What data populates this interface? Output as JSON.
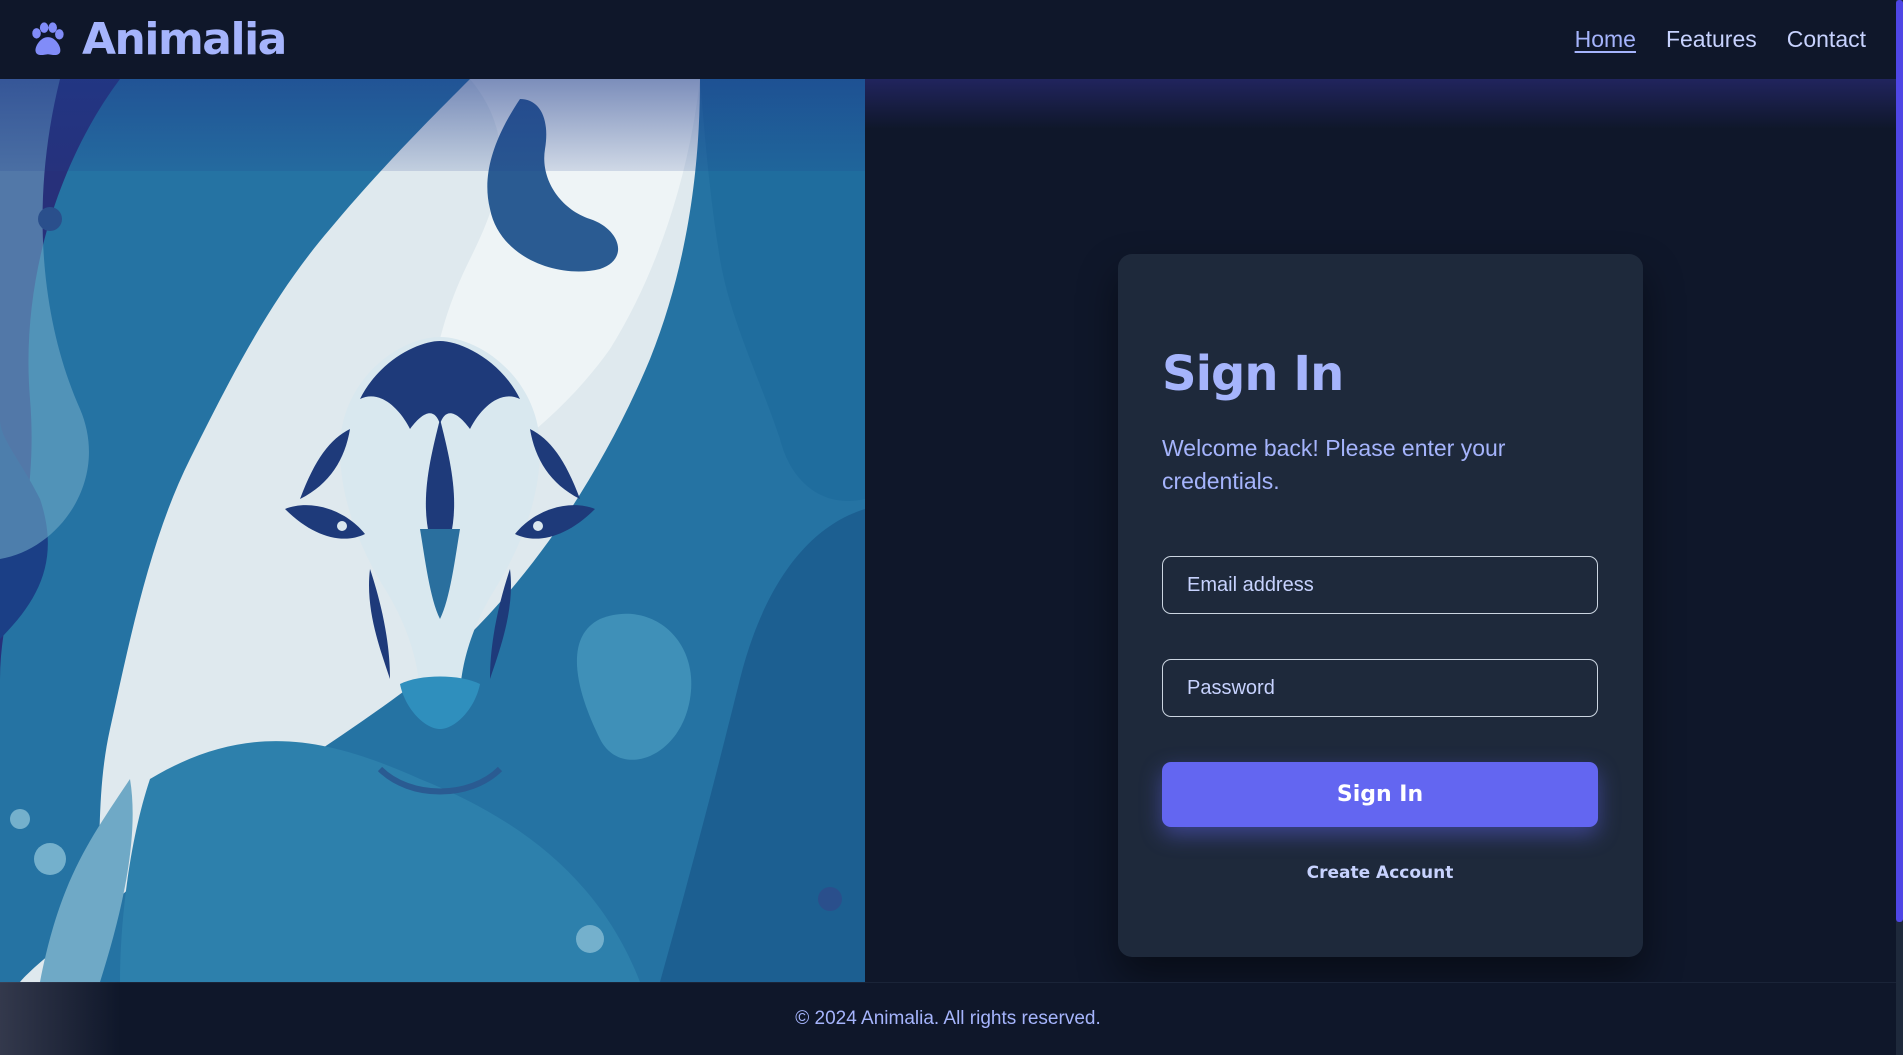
{
  "header": {
    "brand_name": "Animalia",
    "logo_icon": "paw-icon",
    "nav": [
      {
        "label": "Home",
        "active": true
      },
      {
        "label": "Features",
        "active": false
      },
      {
        "label": "Contact",
        "active": false
      }
    ]
  },
  "hero": {
    "image_subject": "stylized blue tiger face illustration"
  },
  "signin": {
    "title": "Sign In",
    "subtitle": "Welcome back! Please enter your credentials.",
    "email_placeholder": "Email address",
    "email_value": "",
    "password_placeholder": "Password",
    "password_value": "",
    "submit_label": "Sign In",
    "create_account_label": "Create Account"
  },
  "footer": {
    "text": "© 2024 Animalia. All rights reserved."
  },
  "colors": {
    "background": "#0f172a",
    "card": "#1e293b",
    "accent": "#6366f1",
    "accent_light": "#a5b4fc",
    "hero_dark_blue": "#1e3a8a",
    "hero_light": "#dbe7ee",
    "hero_teal": "#2a7aa8"
  }
}
